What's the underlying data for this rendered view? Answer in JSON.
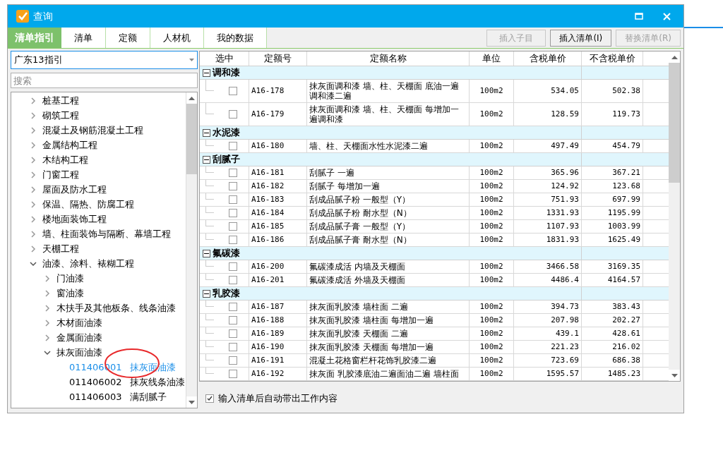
{
  "window": {
    "title": "查询"
  },
  "tabs": [
    {
      "label": "清单指引",
      "selected": true
    },
    {
      "label": "清单",
      "selected": false
    },
    {
      "label": "定额",
      "selected": false
    },
    {
      "label": "人材机",
      "selected": false
    },
    {
      "label": "我的数据",
      "selected": false
    }
  ],
  "toolbar_buttons": [
    {
      "label": "插入子目",
      "disabled": true
    },
    {
      "label": "插入清单(I)",
      "disabled": false
    },
    {
      "label": "替换清单(R)",
      "disabled": true
    }
  ],
  "guide_select": {
    "value": "广东13指引"
  },
  "search": {
    "placeholder": "搜索"
  },
  "tree": [
    {
      "label": "桩基工程",
      "expanded": false
    },
    {
      "label": "砌筑工程",
      "expanded": false
    },
    {
      "label": "混凝土及钢筋混凝土工程",
      "expanded": false
    },
    {
      "label": "金属结构工程",
      "expanded": false
    },
    {
      "label": "木结构工程",
      "expanded": false
    },
    {
      "label": "门窗工程",
      "expanded": false
    },
    {
      "label": "屋面及防水工程",
      "expanded": false
    },
    {
      "label": "保温、隔热、防腐工程",
      "expanded": false
    },
    {
      "label": "楼地面装饰工程",
      "expanded": false
    },
    {
      "label": "墙、柱面装饰与隔断、幕墙工程",
      "expanded": false
    },
    {
      "label": "天棚工程",
      "expanded": false
    },
    {
      "label": "油漆、涂料、裱糊工程",
      "expanded": true,
      "children": [
        {
          "label": "门油漆",
          "expanded": false
        },
        {
          "label": "窗油漆",
          "expanded": false
        },
        {
          "label": "木扶手及其他板条、线条油漆",
          "expanded": false
        },
        {
          "label": "木材面油漆",
          "expanded": false
        },
        {
          "label": "金属面油漆",
          "expanded": false
        },
        {
          "label": "抹灰面油漆",
          "expanded": true,
          "children": [
            {
              "code": "011406001",
              "label": "抹灰面油漆",
              "selected": true
            },
            {
              "code": "011406002",
              "label": "抹灰线条油漆",
              "selected": false
            },
            {
              "code": "011406003",
              "label": "满刮腻子",
              "selected": false
            }
          ]
        }
      ]
    }
  ],
  "table": {
    "columns": [
      "选中",
      "定额号",
      "定额名称",
      "单位",
      "含税单价",
      "不含税单价"
    ],
    "groups": [
      {
        "name": "调和漆",
        "expanded": true,
        "rows": [
          {
            "checked": false,
            "code": "A16-178",
            "name": "抹灰面调和漆 墙、柱、天棚面 底油一遍调和漆二遍",
            "unit": "100m2",
            "price_tax": "534.05",
            "price_notax": "502.38"
          },
          {
            "checked": false,
            "code": "A16-179",
            "name": "抹灰面调和漆 墙、柱、天棚面 每增加一遍调和漆",
            "unit": "100m2",
            "price_tax": "128.59",
            "price_notax": "119.73"
          }
        ]
      },
      {
        "name": "水泥漆",
        "expanded": true,
        "rows": [
          {
            "checked": false,
            "code": "A16-180",
            "name": "墙、柱、天棚面水性水泥漆二遍",
            "unit": "100m2",
            "price_tax": "497.49",
            "price_notax": "454.79"
          }
        ]
      },
      {
        "name": "刮腻子",
        "expanded": true,
        "rows": [
          {
            "checked": false,
            "code": "A16-181",
            "name": "刮腻子 一遍",
            "unit": "100m2",
            "price_tax": "365.96",
            "price_notax": "367.21"
          },
          {
            "checked": false,
            "code": "A16-182",
            "name": "刮腻子 每增加一遍",
            "unit": "100m2",
            "price_tax": "124.92",
            "price_notax": "123.68"
          },
          {
            "checked": false,
            "code": "A16-183",
            "name": "刮成品腻子粉 一般型（Y）",
            "unit": "100m2",
            "price_tax": "751.93",
            "price_notax": "697.99"
          },
          {
            "checked": false,
            "code": "A16-184",
            "name": "刮成品腻子粉 耐水型（N）",
            "unit": "100m2",
            "price_tax": "1331.93",
            "price_notax": "1195.99"
          },
          {
            "checked": false,
            "code": "A16-185",
            "name": "刮成品腻子膏 一般型（Y）",
            "unit": "100m2",
            "price_tax": "1107.93",
            "price_notax": "1003.99"
          },
          {
            "checked": false,
            "code": "A16-186",
            "name": "刮成品腻子膏 耐水型（N）",
            "unit": "100m2",
            "price_tax": "1831.93",
            "price_notax": "1625.49"
          }
        ]
      },
      {
        "name": "氟碳漆",
        "expanded": true,
        "rows": [
          {
            "checked": false,
            "code": "A16-200",
            "name": "氟碳漆成活 内墙及天棚面",
            "unit": "100m2",
            "price_tax": "3466.58",
            "price_notax": "3169.35"
          },
          {
            "checked": false,
            "code": "A16-201",
            "name": "氟碳漆成活 外墙及天棚面",
            "unit": "100m2",
            "price_tax": "4486.4",
            "price_notax": "4164.57"
          }
        ]
      },
      {
        "name": "乳胶漆",
        "expanded": true,
        "rows": [
          {
            "checked": false,
            "code": "A16-187",
            "name": "抹灰面乳胶漆 墙柱面 二遍",
            "unit": "100m2",
            "price_tax": "394.73",
            "price_notax": "383.43"
          },
          {
            "checked": false,
            "code": "A16-188",
            "name": "抹灰面乳胶漆 墙柱面 每增加一遍",
            "unit": "100m2",
            "price_tax": "207.98",
            "price_notax": "202.27"
          },
          {
            "checked": false,
            "code": "A16-189",
            "name": "抹灰面乳胶漆 天棚面 二遍",
            "unit": "100m2",
            "price_tax": "439.1",
            "price_notax": "428.61"
          },
          {
            "checked": false,
            "code": "A16-190",
            "name": "抹灰面乳胶漆 天棚面 每增加一遍",
            "unit": "100m2",
            "price_tax": "221.23",
            "price_notax": "216.02"
          },
          {
            "checked": false,
            "code": "A16-191",
            "name": "混凝土花格窗栏杆花饰乳胶漆二遍",
            "unit": "100m2",
            "price_tax": "723.69",
            "price_notax": "686.38"
          },
          {
            "checked": false,
            "code": "A16-192",
            "name": "抹灰面 乳胶漆底油二遍面油二遍 墙柱面",
            "unit": "100m2",
            "price_tax": "1595.57",
            "price_notax": "1485.23"
          }
        ]
      }
    ]
  },
  "auto_content": {
    "label": "输入清单后自动带出工作内容",
    "checked": true
  }
}
